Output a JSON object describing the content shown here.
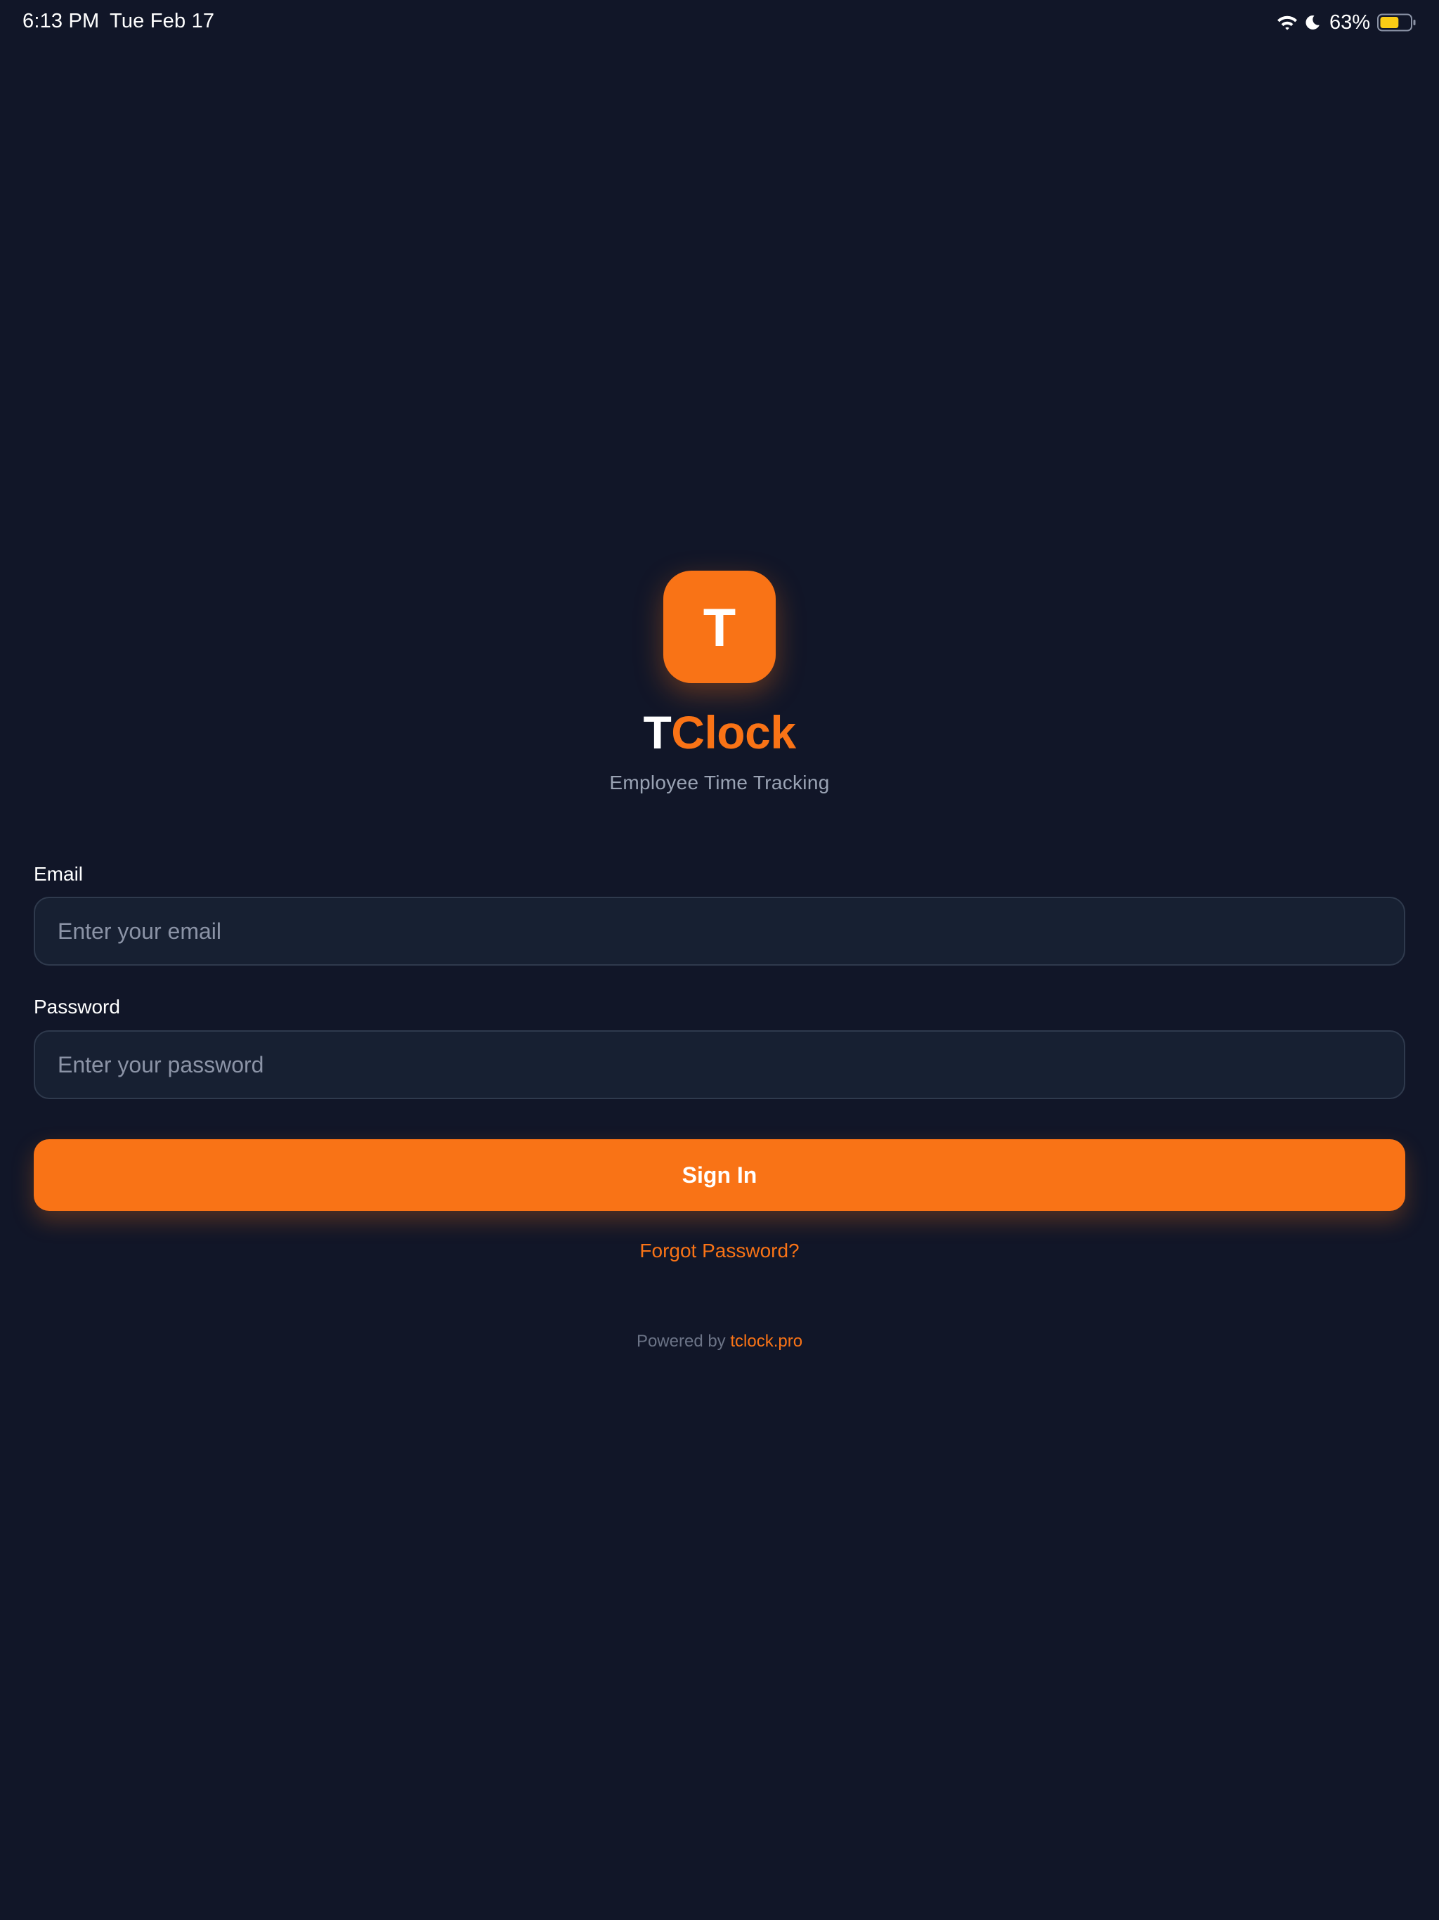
{
  "status_bar": {
    "time": "6:13 PM",
    "date": "Tue Feb 17",
    "battery_percent": "63%",
    "battery_level": 0.63,
    "icons": [
      "wifi-icon",
      "moon-icon",
      "battery-icon"
    ]
  },
  "brand": {
    "logo_letter": "T",
    "title_first": "T",
    "title_rest": "Clock",
    "subtitle": "Employee Time Tracking"
  },
  "form": {
    "email_label": "Email",
    "email_placeholder": "Enter your email",
    "email_value": "",
    "password_label": "Password",
    "password_placeholder": "Enter your password",
    "password_value": "",
    "sign_in_label": "Sign In",
    "forgot_label": "Forgot Password?"
  },
  "footer": {
    "powered_by": "Powered by",
    "link": "tclock.pro"
  },
  "colors": {
    "background": "#111628",
    "accent": "#f97316",
    "field_background": "#172032",
    "field_border": "#2f3a4d",
    "muted_text": "#9aa3b4",
    "battery_fill": "#facc15"
  }
}
